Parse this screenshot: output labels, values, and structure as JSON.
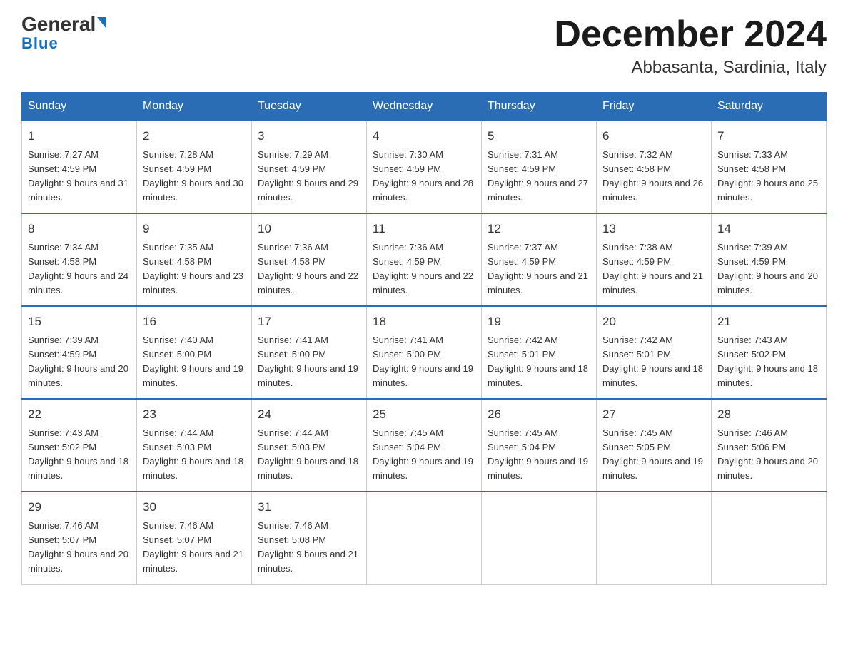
{
  "header": {
    "logo_general": "General",
    "logo_blue": "Blue",
    "month_year": "December 2024",
    "location": "Abbasanta, Sardinia, Italy"
  },
  "days_of_week": [
    "Sunday",
    "Monday",
    "Tuesday",
    "Wednesday",
    "Thursday",
    "Friday",
    "Saturday"
  ],
  "weeks": [
    [
      {
        "day": "1",
        "sunrise": "7:27 AM",
        "sunset": "4:59 PM",
        "daylight": "9 hours and 31 minutes."
      },
      {
        "day": "2",
        "sunrise": "7:28 AM",
        "sunset": "4:59 PM",
        "daylight": "9 hours and 30 minutes."
      },
      {
        "day": "3",
        "sunrise": "7:29 AM",
        "sunset": "4:59 PM",
        "daylight": "9 hours and 29 minutes."
      },
      {
        "day": "4",
        "sunrise": "7:30 AM",
        "sunset": "4:59 PM",
        "daylight": "9 hours and 28 minutes."
      },
      {
        "day": "5",
        "sunrise": "7:31 AM",
        "sunset": "4:59 PM",
        "daylight": "9 hours and 27 minutes."
      },
      {
        "day": "6",
        "sunrise": "7:32 AM",
        "sunset": "4:58 PM",
        "daylight": "9 hours and 26 minutes."
      },
      {
        "day": "7",
        "sunrise": "7:33 AM",
        "sunset": "4:58 PM",
        "daylight": "9 hours and 25 minutes."
      }
    ],
    [
      {
        "day": "8",
        "sunrise": "7:34 AM",
        "sunset": "4:58 PM",
        "daylight": "9 hours and 24 minutes."
      },
      {
        "day": "9",
        "sunrise": "7:35 AM",
        "sunset": "4:58 PM",
        "daylight": "9 hours and 23 minutes."
      },
      {
        "day": "10",
        "sunrise": "7:36 AM",
        "sunset": "4:58 PM",
        "daylight": "9 hours and 22 minutes."
      },
      {
        "day": "11",
        "sunrise": "7:36 AM",
        "sunset": "4:59 PM",
        "daylight": "9 hours and 22 minutes."
      },
      {
        "day": "12",
        "sunrise": "7:37 AM",
        "sunset": "4:59 PM",
        "daylight": "9 hours and 21 minutes."
      },
      {
        "day": "13",
        "sunrise": "7:38 AM",
        "sunset": "4:59 PM",
        "daylight": "9 hours and 21 minutes."
      },
      {
        "day": "14",
        "sunrise": "7:39 AM",
        "sunset": "4:59 PM",
        "daylight": "9 hours and 20 minutes."
      }
    ],
    [
      {
        "day": "15",
        "sunrise": "7:39 AM",
        "sunset": "4:59 PM",
        "daylight": "9 hours and 20 minutes."
      },
      {
        "day": "16",
        "sunrise": "7:40 AM",
        "sunset": "5:00 PM",
        "daylight": "9 hours and 19 minutes."
      },
      {
        "day": "17",
        "sunrise": "7:41 AM",
        "sunset": "5:00 PM",
        "daylight": "9 hours and 19 minutes."
      },
      {
        "day": "18",
        "sunrise": "7:41 AM",
        "sunset": "5:00 PM",
        "daylight": "9 hours and 19 minutes."
      },
      {
        "day": "19",
        "sunrise": "7:42 AM",
        "sunset": "5:01 PM",
        "daylight": "9 hours and 18 minutes."
      },
      {
        "day": "20",
        "sunrise": "7:42 AM",
        "sunset": "5:01 PM",
        "daylight": "9 hours and 18 minutes."
      },
      {
        "day": "21",
        "sunrise": "7:43 AM",
        "sunset": "5:02 PM",
        "daylight": "9 hours and 18 minutes."
      }
    ],
    [
      {
        "day": "22",
        "sunrise": "7:43 AM",
        "sunset": "5:02 PM",
        "daylight": "9 hours and 18 minutes."
      },
      {
        "day": "23",
        "sunrise": "7:44 AM",
        "sunset": "5:03 PM",
        "daylight": "9 hours and 18 minutes."
      },
      {
        "day": "24",
        "sunrise": "7:44 AM",
        "sunset": "5:03 PM",
        "daylight": "9 hours and 18 minutes."
      },
      {
        "day": "25",
        "sunrise": "7:45 AM",
        "sunset": "5:04 PM",
        "daylight": "9 hours and 19 minutes."
      },
      {
        "day": "26",
        "sunrise": "7:45 AM",
        "sunset": "5:04 PM",
        "daylight": "9 hours and 19 minutes."
      },
      {
        "day": "27",
        "sunrise": "7:45 AM",
        "sunset": "5:05 PM",
        "daylight": "9 hours and 19 minutes."
      },
      {
        "day": "28",
        "sunrise": "7:46 AM",
        "sunset": "5:06 PM",
        "daylight": "9 hours and 20 minutes."
      }
    ],
    [
      {
        "day": "29",
        "sunrise": "7:46 AM",
        "sunset": "5:07 PM",
        "daylight": "9 hours and 20 minutes."
      },
      {
        "day": "30",
        "sunrise": "7:46 AM",
        "sunset": "5:07 PM",
        "daylight": "9 hours and 21 minutes."
      },
      {
        "day": "31",
        "sunrise": "7:46 AM",
        "sunset": "5:08 PM",
        "daylight": "9 hours and 21 minutes."
      },
      {
        "day": "",
        "sunrise": "",
        "sunset": "",
        "daylight": ""
      },
      {
        "day": "",
        "sunrise": "",
        "sunset": "",
        "daylight": ""
      },
      {
        "day": "",
        "sunrise": "",
        "sunset": "",
        "daylight": ""
      },
      {
        "day": "",
        "sunrise": "",
        "sunset": "",
        "daylight": ""
      }
    ]
  ]
}
